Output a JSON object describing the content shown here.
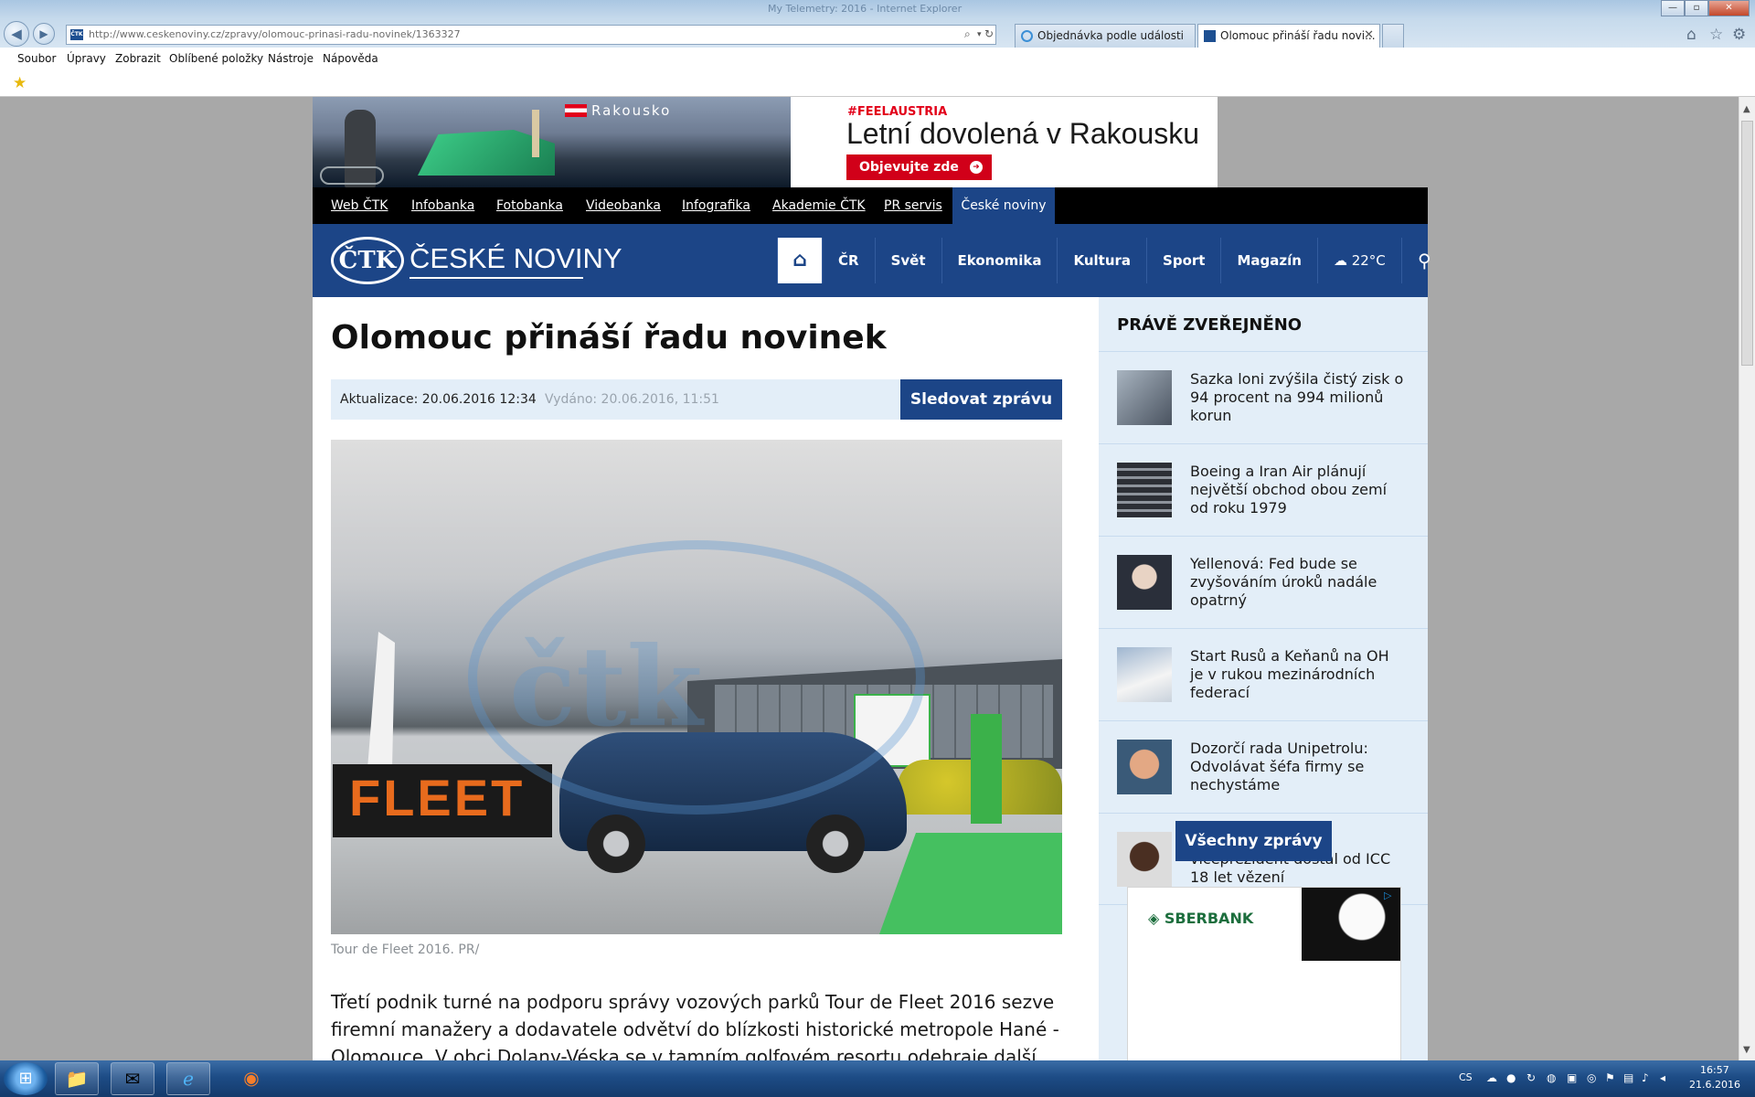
{
  "browser": {
    "title_text": "My Telemetry: 2016 - Internet Explorer",
    "url": "http://www.ceskenoviny.cz/zpravy/olomouc-prinasi-radu-novinek/1363327",
    "tabs": [
      {
        "label": "Objednávka podle události"
      },
      {
        "label": "Olomouc přináší řadu novi..."
      }
    ],
    "menu": [
      "Soubor",
      "Úpravy",
      "Zobrazit",
      "Oblíbené položky",
      "Nástroje",
      "Nápověda"
    ]
  },
  "ad_banner": {
    "flag_label": "Rakousko",
    "hashtag": "#FEELAUSTRIA",
    "headline": "Letní dovolená v Rakousku",
    "cta": "Objevujte zde"
  },
  "ctk_bar": {
    "links": [
      "Web ČTK",
      "Infobanka",
      "Fotobanka",
      "Videobanka",
      "Infografika",
      "Akademie ČTK",
      "PR servis"
    ],
    "active": "České noviny"
  },
  "header": {
    "logo_mark": "ČTK",
    "logo_text": "ČESKÉ NOVINY",
    "nav": [
      "ČR",
      "Svět",
      "Ekonomika",
      "Kultura",
      "Sport",
      "Magazín"
    ],
    "weather": "22°C"
  },
  "article": {
    "title": "Olomouc přináší řadu novinek",
    "updated": "Aktualizace: 20.06.2016 12:34",
    "published": "Vydáno: 20.06.2016, 11:51",
    "follow_label": "Sledovat zprávu",
    "photo_caption": "Tour de Fleet 2016. PR/",
    "photo_texts": {
      "banner": "FLEET",
      "watermark": "čtk"
    },
    "lead": "Třetí podnik turné na podporu správy vozových parků Tour de Fleet 2016 sezve firemní manažery a dodavatele odvětví do blízkosti historické metropole Hané - Olomouce. V obci Dolany-Véska se v tamním golfovém resortu odehraje další"
  },
  "sidebar": {
    "title": "PRÁVĚ ZVEŘEJNĚNO",
    "news": [
      {
        "title": "Sazka loni zvýšila čistý zisk o 94 procent na 994 milionů korun"
      },
      {
        "title": "Boeing a Iran Air plánují největší obchod obou zemí od roku 1979"
      },
      {
        "title": "Yellenová: Fed bude se zvyšováním úroků nadále opatrný"
      },
      {
        "title": "Start Rusů a Keňanů na OH je v rukou mezinárodních federací"
      },
      {
        "title": "Dozorčí rada Unipetrolu: Odvolávat šéfa firmy se nechystáme"
      },
      {
        "title": "Bývalý konžský viceprezident dostal od ICC 18 let vězení"
      }
    ],
    "all_news_label": "Všechny zprávy",
    "ad_logo": "SBERBANK"
  },
  "taskbar": {
    "lang": "CS",
    "time": "16:57",
    "date": "21.6.2016"
  },
  "colors": {
    "brand_blue": "#1c4587",
    "sidebar_bg": "#e3eef8",
    "ad_red": "#d10019"
  }
}
